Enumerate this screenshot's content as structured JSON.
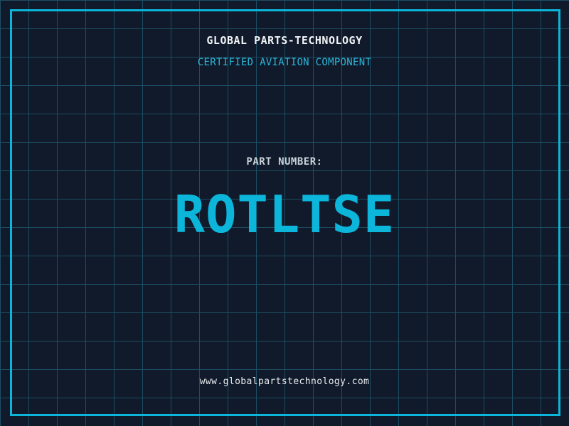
{
  "label": {
    "company_name": "GLOBAL PARTS-TECHNOLOGY",
    "certification": "CERTIFIED AVIATION COMPONENT",
    "part_number_label": "PART NUMBER:",
    "part_number": "ROTLTSE",
    "website": "www.globalpartstechnology.com"
  },
  "colors": {
    "background": "#101a2b",
    "grid_line": "#1d4d62",
    "frame_cyan": "#0cb6da",
    "accent_cyan": "#2ab6d8",
    "title_white": "#f2f4f6",
    "label_gray": "#c9d2da",
    "url_white": "#e8ebee"
  }
}
